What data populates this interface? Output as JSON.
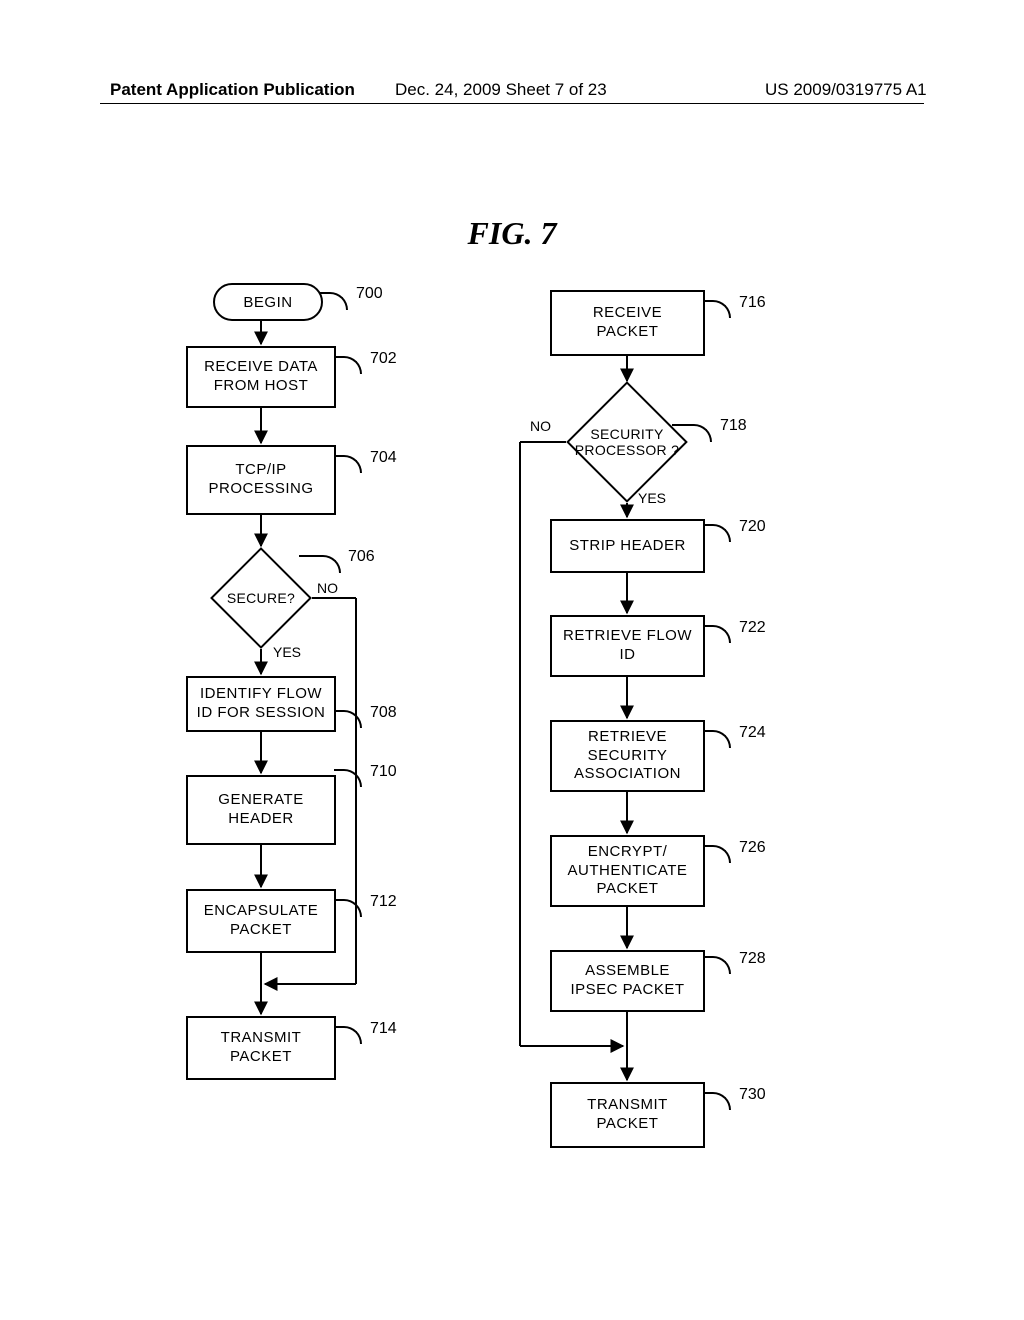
{
  "header": {
    "left": "Patent Application Publication",
    "middle": "Dec. 24, 2009  Sheet 7 of 23",
    "right": "US 2009/0319775 A1"
  },
  "figure_title": "FIG. 7",
  "shapes": {
    "begin": {
      "label": "BEGIN",
      "ref": "700"
    },
    "receive_data": {
      "label": "RECEIVE  DATA\nFROM  HOST",
      "ref": "702"
    },
    "tcpip": {
      "label": "TCP/IP\nPROCESSING",
      "ref": "704"
    },
    "secure": {
      "label": "SECURE?",
      "ref": "706",
      "yes": "YES",
      "no": "NO"
    },
    "identify_flow": {
      "label": "IDENTIFY  FLOW\nID  FOR  SESSION",
      "ref": "708"
    },
    "gen_header": {
      "label": "GENERATE\nHEADER",
      "ref": "710"
    },
    "encapsulate": {
      "label": "ENCAPSULATE\nPACKET",
      "ref": "712"
    },
    "transmit_left": {
      "label": "TRANSMIT\nPACKET",
      "ref": "714"
    },
    "receive_packet": {
      "label": "RECEIVE\nPACKET",
      "ref": "716"
    },
    "sec_proc": {
      "label": "SECURITY\nPROCESSOR\n?",
      "ref": "718",
      "yes": "YES",
      "no": "NO"
    },
    "strip_header": {
      "label": "STRIP  HEADER",
      "ref": "720"
    },
    "retrieve_flow": {
      "label": "RETRIEVE  FLOW\nID",
      "ref": "722"
    },
    "retrieve_sa": {
      "label": "RETRIEVE\nSECURITY\nASSOCIATION",
      "ref": "724"
    },
    "encrypt": {
      "label": "ENCRYPT/\nAUTHENTICATE\nPACKET",
      "ref": "726"
    },
    "assemble": {
      "label": "ASSEMBLE\nIPSEC  PACKET",
      "ref": "728"
    },
    "transmit_right": {
      "label": "TRANSMIT\nPACKET",
      "ref": "730"
    }
  }
}
